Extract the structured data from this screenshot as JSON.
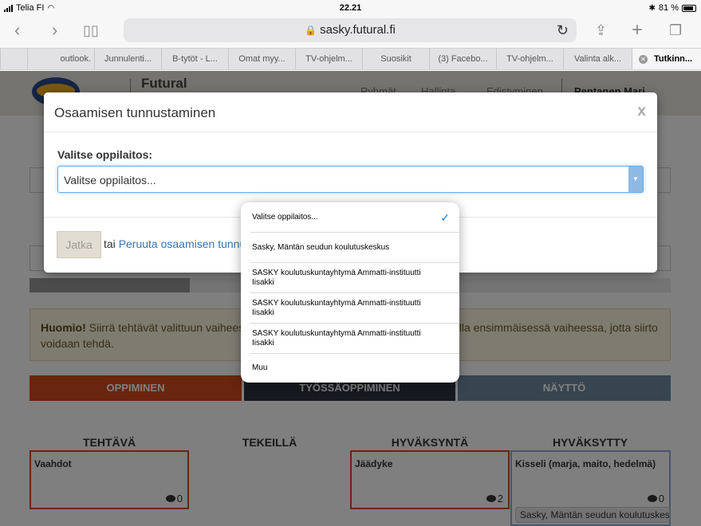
{
  "status_bar": {
    "carrier": "Telia FI",
    "time": "22.21",
    "battery": "81 %"
  },
  "browser": {
    "url": "sasky.futural.fi",
    "tabs": [
      "outlook.",
      "Junnulenti...",
      "B-tytöt - L...",
      "Omat myy...",
      "TV-ohjelm...",
      "Suosikit",
      "(3) Facebo...",
      "TV-ohjelm...",
      "Valinta alk...",
      "Tutkinn..."
    ]
  },
  "site": {
    "title": "Futural",
    "nav": [
      "Ryhmät",
      "Hallinta",
      "Edistyminen"
    ],
    "user": "Pentanen Mari"
  },
  "background_page": {
    "alert_strong": "Huomio!",
    "alert_text_left": "Siirrä tehtävät valittuun vaiheeseen",
    "alert_text_right": "olla ensimmäisessä vaiheessa, jotta siirto",
    "alert_text_line2": "voidaan tehdä.",
    "progress": 0.25,
    "stages": [
      "OPPIMINEN",
      "TYÖSSÄOPPIMINEN",
      "NÄYTTÖ"
    ],
    "stage_colors": [
      "#d44a1c",
      "#2c3440",
      "#6f8aa3"
    ],
    "columns": [
      "TEHTÄVÄ",
      "TEKEILLÄ",
      "HYVÄKSYNTÄ",
      "HYVÄKSYTTY"
    ],
    "cards": [
      {
        "title": "Vaahdot",
        "count": "0"
      },
      {
        "title": "Jäädyke",
        "count": "2"
      },
      {
        "title": "Kisseli (marja, maito, hedelmä)",
        "count": "0",
        "tag": "Sasky, Mäntän seudun koulutuskeskus"
      }
    ]
  },
  "modal": {
    "title": "Osaamisen tunnustaminen",
    "close": "x",
    "label": "Valitse oppilaitos:",
    "select_value": "Valitse oppilaitos...",
    "continue_button": "Jatka",
    "or_text": "tai",
    "cancel_link": "Peruuta osaamisen tunnus"
  },
  "dropdown": {
    "options": [
      "Valitse oppilaitos...",
      "Sasky, Mäntän seudun koulutuskeskus",
      "SASKY koulutuskuntayhtymä Ammatti-instituutti Iisakki",
      "SASKY koulutuskuntayhtymä Ammatti-instituutti Iisakki",
      "SASKY koulutuskuntayhtymä Ammatti-instituutti Iisakki",
      "Muu"
    ],
    "selected_index": 0
  }
}
